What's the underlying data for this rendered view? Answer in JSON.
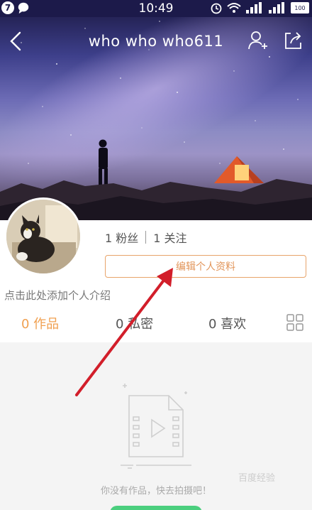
{
  "status_bar": {
    "badge_count": "7",
    "time": "10:49",
    "battery": "100"
  },
  "nav": {
    "title": "who who who611"
  },
  "profile": {
    "fans": "1 粉丝",
    "following": "1 关注",
    "edit_label": "编辑个人资料",
    "intro_placeholder": "点击此处添加个人介绍"
  },
  "tabs": [
    {
      "label": "0 作品",
      "active": true
    },
    {
      "label": "0 私密",
      "active": false
    },
    {
      "label": "0 喜欢",
      "active": false
    }
  ],
  "empty": {
    "message": "你没有作品，快去拍摄吧！"
  },
  "watermark": "百度经验",
  "colors": {
    "accent": "#f0a050",
    "annotation_arrow": "#d21e2a",
    "shoot_button": "#4bcf7e"
  }
}
